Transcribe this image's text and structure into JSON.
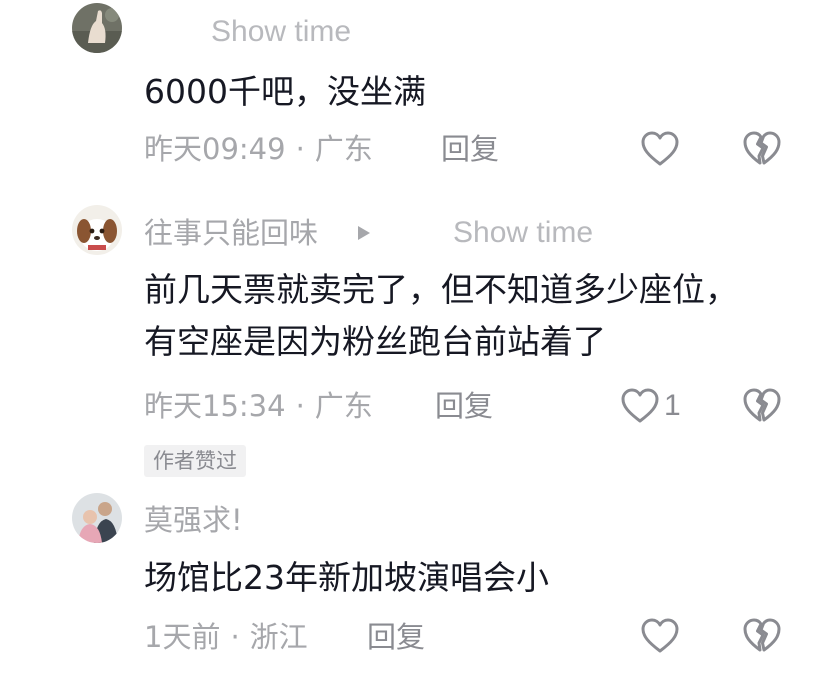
{
  "comments": [
    {
      "username": "",
      "show_time": "Show time",
      "text_lines": [
        "6000千吧，没坐满"
      ],
      "time": "昨天09:49",
      "location": "广东",
      "reply": "回复",
      "likes": "",
      "badge": ""
    },
    {
      "username": "往事只能回味",
      "show_time": "Show time",
      "text_lines": [
        "前几天票就卖完了，但不知道多少座位，",
        "有空座是因为粉丝跑台前站着了"
      ],
      "time": "昨天15:34",
      "location": "广东",
      "reply": "回复",
      "likes": "1",
      "badge": "作者赞过"
    },
    {
      "username": "莫强求!",
      "show_time": "",
      "text_lines": [
        "场馆比23年新加坡演唱会小"
      ],
      "time": "1天前",
      "location": "浙江",
      "reply": "回复",
      "likes": "",
      "badge": ""
    }
  ],
  "separator": "·",
  "icons": {
    "like": "heart-outline-icon",
    "dislike": "broken-heart-icon",
    "play": "play-triangle-icon"
  },
  "colors": {
    "text": "#161823",
    "secondary": "#a6a7ab",
    "icon": "#8a8b91"
  }
}
